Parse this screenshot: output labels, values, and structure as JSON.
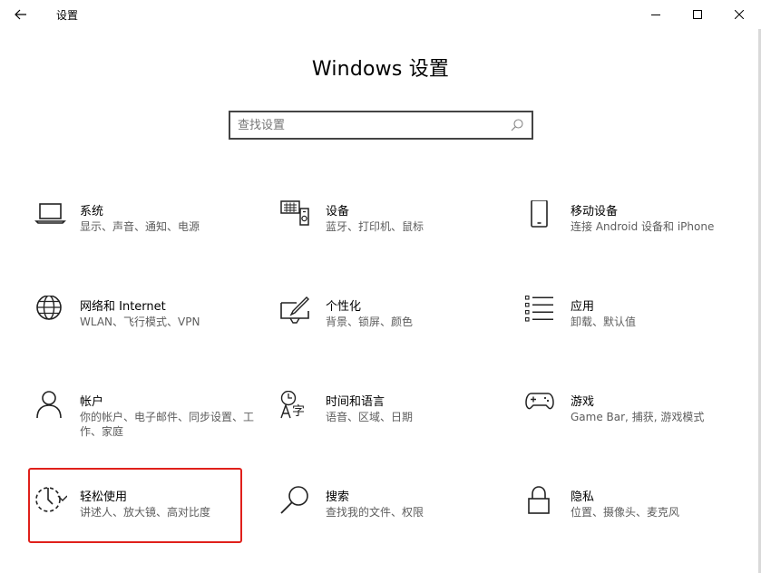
{
  "window": {
    "title": "设置",
    "controls": {
      "minimize": "minimize-icon",
      "maximize": "maximize-icon",
      "close": "close-icon"
    }
  },
  "header": {
    "title": "Windows 设置",
    "search_placeholder": "查找设置"
  },
  "tiles": [
    {
      "name": "系统",
      "desc": "显示、声音、通知、电源",
      "icon": "laptop-icon"
    },
    {
      "name": "设备",
      "desc": "蓝牙、打印机、鼠标",
      "icon": "devices-icon"
    },
    {
      "name": "移动设备",
      "desc": "连接 Android 设备和 iPhone",
      "icon": "phone-icon"
    },
    {
      "name": "网络和 Internet",
      "desc": "WLAN、飞行模式、VPN",
      "icon": "globe-icon"
    },
    {
      "name": "个性化",
      "desc": "背景、锁屏、颜色",
      "icon": "paintbrush-icon"
    },
    {
      "name": "应用",
      "desc": "卸载、默认值",
      "icon": "apps-list-icon"
    },
    {
      "name": "帐户",
      "desc": "你的帐户、电子邮件、同步设置、工作、家庭",
      "icon": "person-icon"
    },
    {
      "name": "时间和语言",
      "desc": "语音、区域、日期",
      "icon": "time-language-icon"
    },
    {
      "name": "游戏",
      "desc": "Game Bar, 捕获, 游戏模式",
      "icon": "gamepad-icon"
    },
    {
      "name": "轻松使用",
      "desc": "讲述人、放大镜、高对比度",
      "icon": "ease-of-access-icon"
    },
    {
      "name": "搜索",
      "desc": "查找我的文件、权限",
      "icon": "search-icon"
    },
    {
      "name": "隐私",
      "desc": "位置、摄像头、麦克风",
      "icon": "lock-icon"
    }
  ],
  "colors": {
    "highlight_border": "#e0201b",
    "description_text": "#5d5d5d"
  }
}
